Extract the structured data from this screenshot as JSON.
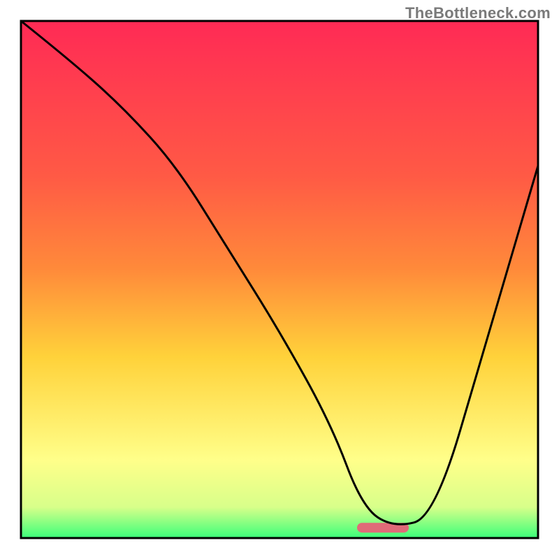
{
  "watermark": "TheBottleneck.com",
  "chart_data": {
    "type": "line",
    "title": "",
    "xlabel": "",
    "ylabel": "",
    "xlim": [
      0,
      100
    ],
    "ylim": [
      0,
      100
    ],
    "background_gradient": {
      "top": "#ff2a55",
      "mid_upper": "#ff8a3a",
      "mid": "#ffd23a",
      "mid_lower": "#ffff8a",
      "bottom": "#3aff7a"
    },
    "series": [
      {
        "name": "bottleneck-curve",
        "x": [
          0,
          10,
          20,
          30,
          40,
          50,
          60,
          66,
          72,
          80,
          90,
          100
        ],
        "y": [
          100,
          92,
          83,
          72,
          56,
          40,
          22,
          6,
          2,
          4,
          38,
          72
        ]
      }
    ],
    "marker": {
      "name": "optimal-zone",
      "x_center": 70,
      "width": 10,
      "color": "#e06a78"
    },
    "frame_color": "#000000",
    "curve_color": "#000000"
  }
}
